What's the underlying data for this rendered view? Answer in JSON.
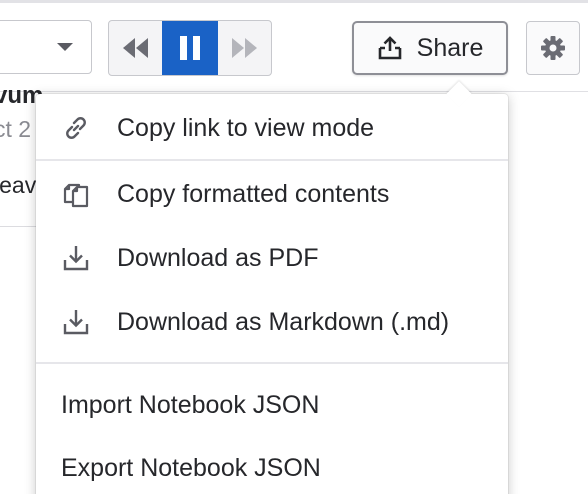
{
  "toolbar": {
    "playback": {
      "rewind_icon": "rewind-icon",
      "pause_icon": "pause-icon",
      "fast_forward_icon": "fast-forward-icon",
      "active_color": "#1a62c6"
    },
    "share_label": "Share",
    "share_icon": "share-upload-icon",
    "settings_icon": "gear-icon"
  },
  "background": {
    "title_fragment": "vum",
    "date_fragment": "ct 2",
    "author_fragment": "leav"
  },
  "share_menu": {
    "items": [
      {
        "label": "Copy link to view mode",
        "icon": "link-icon"
      },
      {
        "label": "Copy formatted contents",
        "icon": "copy-icon"
      },
      {
        "label": "Download as PDF",
        "icon": "download-icon"
      },
      {
        "label": "Download as Markdown (.md)",
        "icon": "download-icon"
      },
      {
        "label": "Import Notebook JSON",
        "icon": ""
      },
      {
        "label": "Export Notebook JSON",
        "icon": ""
      }
    ]
  }
}
